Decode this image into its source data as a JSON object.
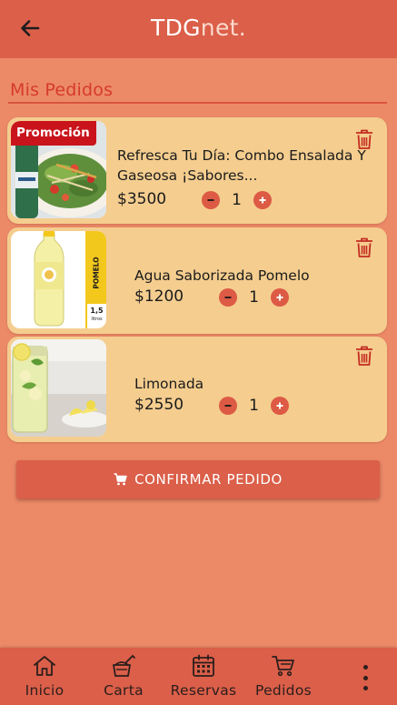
{
  "header": {
    "brand_part1": "TDG",
    "brand_part2": "net.",
    "back_icon": "arrow-left-icon"
  },
  "page": {
    "title": "Mis Pedidos"
  },
  "orders": [
    {
      "name_line1": "Refresca Tu Día: Combo Ensalada Y",
      "name_line2": "Gaseosa ¡Sabores...",
      "price": "$3500",
      "quantity": "1",
      "badge": "Promoción",
      "image": "salad-and-soda-photo"
    },
    {
      "name_line1": "Agua Saborizada Pomelo",
      "name_line2": "",
      "price": "$1200",
      "quantity": "1",
      "image": "pomelo-flavored-water-bottle-photo",
      "bottle_label": "POMELO",
      "bottle_size": "1,5",
      "bottle_unit": "litros"
    },
    {
      "name_line1": "Limonada",
      "name_line2": "",
      "price": "$2550",
      "quantity": "1",
      "image": "lemonade-jar-photo"
    }
  ],
  "confirm_button": {
    "label": "CONFIRMAR PEDIDO",
    "icon": "cart-icon"
  },
  "bottom_nav": {
    "items": [
      {
        "label": "Inicio",
        "icon": "home-icon"
      },
      {
        "label": "Carta",
        "icon": "menu-food-icon"
      },
      {
        "label": "Reservas",
        "icon": "calendar-icon"
      },
      {
        "label": "Pedidos",
        "icon": "cart-icon"
      }
    ],
    "more_icon": "more-vertical-icon"
  },
  "colors": {
    "background": "#ec8a68",
    "header": "#db5f49",
    "card": "#f4cd8f",
    "accent": "#dd5a44",
    "title": "#d63b2a",
    "promo_badge": "#c9141b"
  }
}
